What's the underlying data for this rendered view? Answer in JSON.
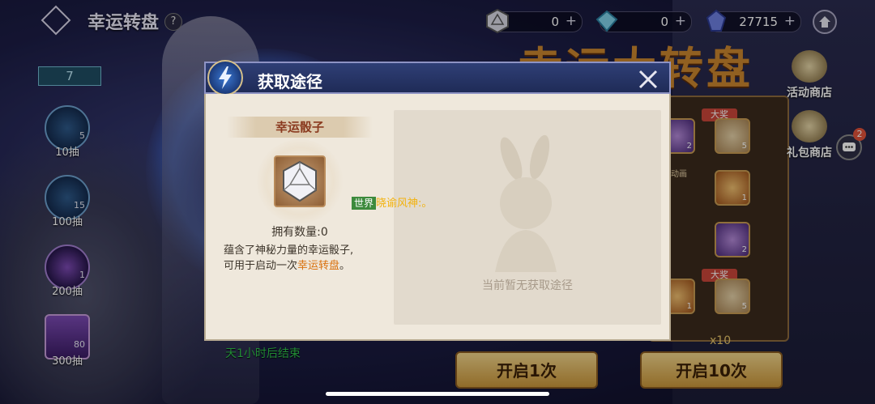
{
  "header": {
    "title": "幸运转盘",
    "help_label": "?",
    "currencies": [
      {
        "name": "dice",
        "value": "0",
        "plus": "+"
      },
      {
        "name": "crystal",
        "value": "0",
        "plus": "+"
      },
      {
        "name": "gem",
        "value": "27715",
        "plus": "+"
      }
    ]
  },
  "left_rail": {
    "level": "7",
    "items": [
      {
        "count": "5",
        "label": "10抽"
      },
      {
        "count": "15",
        "label": "100抽"
      },
      {
        "count": "1",
        "label": "200抽"
      },
      {
        "count": "80",
        "label": "300抽"
      }
    ],
    "end_text": "天1小时后结束"
  },
  "background": {
    "big_title": "幸运大转盘",
    "prize_tags": [
      "大奖",
      "大奖"
    ],
    "wheel_counts": [
      "2",
      "5",
      "1",
      "2",
      "1",
      "5"
    ],
    "animation_label": "动画"
  },
  "right_panel": {
    "activity_shop": "活动商店",
    "gift_shop": "礼包商店",
    "chat_badge": "2"
  },
  "bottom": {
    "open_once": "开启1次",
    "open_ten": "开启10次",
    "x10_label": "x10"
  },
  "modal": {
    "title": "获取途径",
    "item_name": "幸运骰子",
    "owned": "拥有数量:0",
    "desc_line1": "蕴含了神秘力量的幸运骰子,",
    "desc_line2_prefix": "可用于启动一次",
    "desc_line2_highlight": "幸运转盘",
    "desc_line2_suffix": "。",
    "empty_text": "当前暂无获取途径"
  },
  "chat_overlay": {
    "channel": "世界",
    "name": "晓谕风神",
    "message": ":。"
  },
  "colors": {
    "accent_gold": "#c9963a",
    "highlight_orange": "#d9700d",
    "world_green": "#3c8a3c",
    "modal_header": "#2f3f76"
  }
}
